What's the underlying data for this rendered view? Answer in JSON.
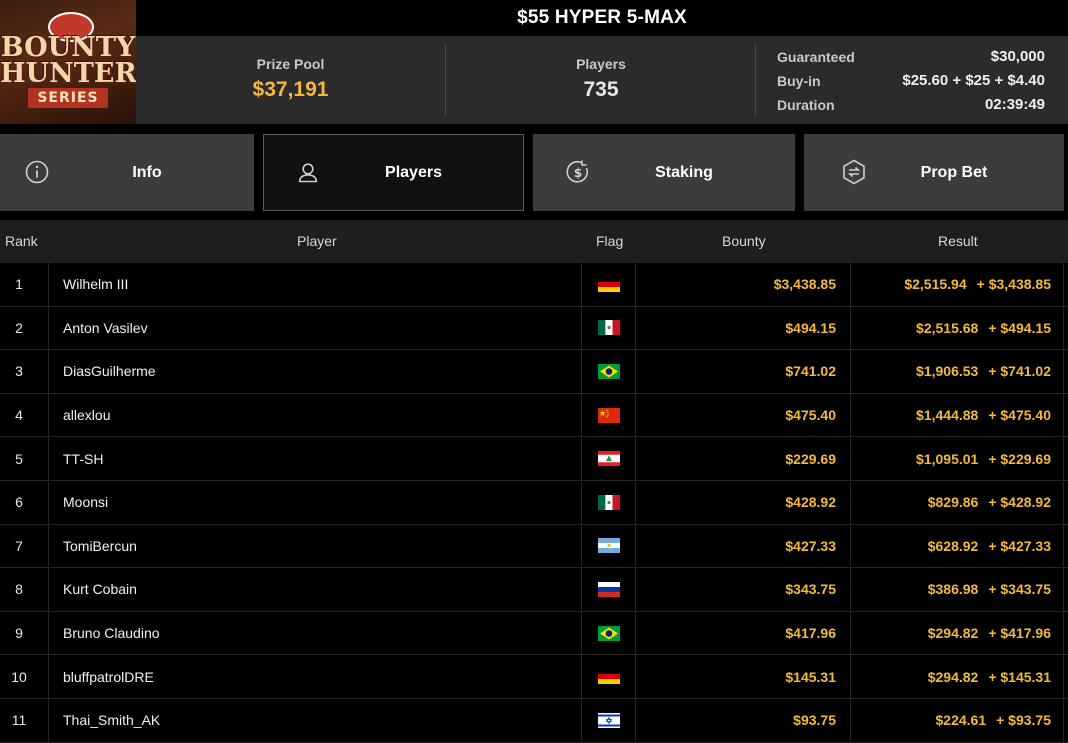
{
  "tournament": {
    "title": "$55 HYPER 5-MAX",
    "logo_text": [
      "BOUNTY",
      "HUNTERS",
      "SERIES"
    ]
  },
  "stats": {
    "prize_pool_label": "Prize Pool",
    "prize_pool_value": "$37,191",
    "players_label": "Players",
    "players_value": "735",
    "guaranteed_label": "Guaranteed",
    "guaranteed_value": "$30,000",
    "buyin_label": "Buy-in",
    "buyin_value": "$25.60 + $25 + $4.40",
    "duration_label": "Duration",
    "duration_value": "02:39:49"
  },
  "tabs": [
    {
      "label": "Info",
      "icon": "info-icon",
      "active": false
    },
    {
      "label": "Players",
      "icon": "user-icon",
      "active": true
    },
    {
      "label": "Staking",
      "icon": "dollar-coin-icon",
      "active": false
    },
    {
      "label": "Prop Bet",
      "icon": "prop-bet-icon",
      "active": false
    }
  ],
  "table": {
    "headers": {
      "rank": "Rank",
      "player": "Player",
      "flag": "Flag",
      "bounty": "Bounty",
      "result": "Result"
    },
    "rows": [
      {
        "rank": "1",
        "player": "Wilhelm III",
        "flag": "germany",
        "bounty": "$3,438.85",
        "result": "$2,515.94",
        "result_bounty": "+ $3,438.85"
      },
      {
        "rank": "2",
        "player": "Anton Vasilev",
        "flag": "mexico",
        "bounty": "$494.15",
        "result": "$2,515.68",
        "result_bounty": "+ $494.15"
      },
      {
        "rank": "3",
        "player": "DiasGuilherme",
        "flag": "brazil",
        "bounty": "$741.02",
        "result": "$1,906.53",
        "result_bounty": "+ $741.02"
      },
      {
        "rank": "4",
        "player": "allexlou",
        "flag": "china",
        "bounty": "$475.40",
        "result": "$1,444.88",
        "result_bounty": "+ $475.40"
      },
      {
        "rank": "5",
        "player": "TT-SH",
        "flag": "lebanon",
        "bounty": "$229.69",
        "result": "$1,095.01",
        "result_bounty": "+ $229.69"
      },
      {
        "rank": "6",
        "player": "Moonsi",
        "flag": "mexico",
        "bounty": "$428.92",
        "result": "$829.86",
        "result_bounty": "+ $428.92"
      },
      {
        "rank": "7",
        "player": "TomiBercun",
        "flag": "argentina",
        "bounty": "$427.33",
        "result": "$628.92",
        "result_bounty": "+ $427.33"
      },
      {
        "rank": "8",
        "player": "Kurt Cobain",
        "flag": "russia",
        "bounty": "$343.75",
        "result": "$386.98",
        "result_bounty": "+ $343.75"
      },
      {
        "rank": "9",
        "player": "Bruno Claudino",
        "flag": "brazil",
        "bounty": "$417.96",
        "result": "$294.82",
        "result_bounty": "+ $417.96"
      },
      {
        "rank": "10",
        "player": "bluffpatrolDRE",
        "flag": "germany",
        "bounty": "$145.31",
        "result": "$294.82",
        "result_bounty": "+ $145.31"
      },
      {
        "rank": "11",
        "player": "Thai_Smith_AK",
        "flag": "israel",
        "bounty": "$93.75",
        "result": "$224.61",
        "result_bounty": "+ $93.75"
      }
    ]
  },
  "colors": {
    "accent": "#f4b93c",
    "panel": "#2b2b2b",
    "tab": "#3c3c3c",
    "tab_active": "#111111",
    "background": "#000000"
  }
}
